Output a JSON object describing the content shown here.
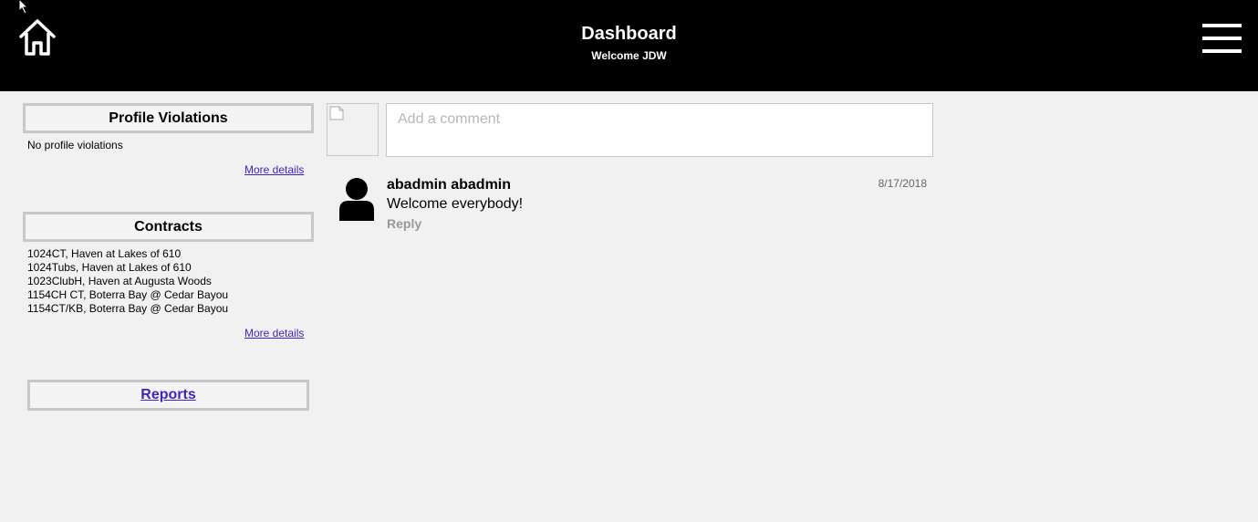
{
  "header": {
    "title": "Dashboard",
    "welcome": "Welcome JDW",
    "background_color": "#000000",
    "text_color": "#ffffff"
  },
  "sidebar": {
    "profile_violations": {
      "title": "Profile Violations",
      "text": "No profile violations",
      "more_link": "More details"
    },
    "contracts": {
      "title": "Contracts",
      "items": [
        "1024CT, Haven at Lakes of 610",
        "1024Tubs, Haven at Lakes of 610",
        "1023ClubH, Haven at Augusta Woods",
        "1154CH CT, Boterra Bay @ Cedar Bayou",
        "1154CT/KB, Boterra Bay @ Cedar Bayou"
      ],
      "more_link": "More details"
    },
    "reports": {
      "label": "Reports"
    },
    "link_color": "#3b24c9"
  },
  "comments": {
    "placeholder": "Add a comment",
    "items": [
      {
        "author": "abadmin abadmin",
        "date": "8/17/2018",
        "text": "Welcome everybody!",
        "reply_label": "Reply"
      }
    ]
  }
}
